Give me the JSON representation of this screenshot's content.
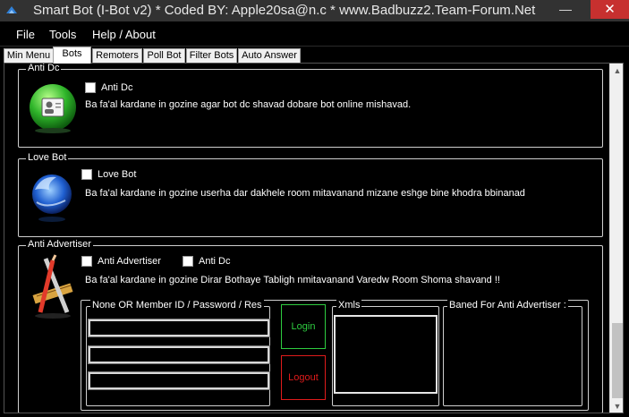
{
  "window": {
    "title": "Smart Bot (I-Bot v2) *  Coded BY: Apple20sa@n.c *  www.Badbuzz2.Team-Forum.Net",
    "minimize_glyph": "—",
    "close_glyph": "✕"
  },
  "menu": [
    "File",
    "Tools",
    "Help / About"
  ],
  "tabs": [
    "Min Menu",
    "Bots",
    "Remoters",
    "Poll Bot",
    "Filter Bots",
    "Auto Answer"
  ],
  "active_tab": "Bots",
  "sections": {
    "anti_dc": {
      "title": "Anti Dc",
      "checkbox_label": "Anti Dc",
      "description": "Ba fa'al kardane in gozine agar bot dc shavad dobare bot online mishavad."
    },
    "love_bot": {
      "title": "Love Bot",
      "checkbox_label": "Love Bot",
      "description": "Ba fa'al kardane in gozine userha dar dakhele room mitavanand mizane eshge bine khodra bbinanad"
    },
    "anti_advertiser": {
      "title": "Anti Advertiser",
      "checkbox_label": "Anti Advertiser",
      "checkbox2_label": "Anti Dc",
      "description": "Ba fa'al kardane in gozine Dirar Bothaye Tabligh nmitavanand Varedw Room Shoma shavand !!",
      "credentials_title": "None OR Member ID / Password / Res",
      "login_label": "Login",
      "logout_label": "Logout",
      "xmls_title": "Xmls",
      "baned_title": "Baned For Anti Advertiser :"
    }
  },
  "scrollbar": {
    "up_glyph": "▲",
    "down_glyph": "▼"
  },
  "colors": {
    "background": "#000000",
    "titlebar": "#323232",
    "close": "#c7302f",
    "login": "#2ecc40",
    "logout": "#e01b1b"
  }
}
